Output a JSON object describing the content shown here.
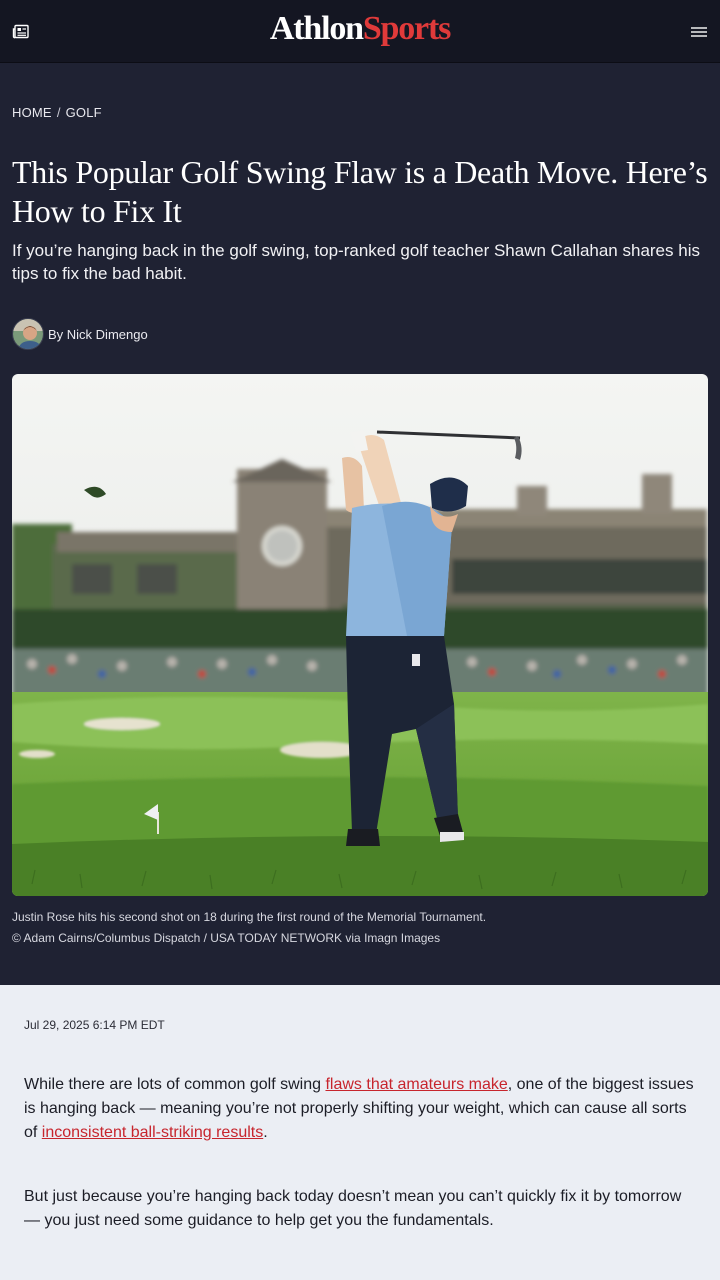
{
  "header": {
    "logo_part1": "Athlon",
    "logo_part2": "Sports",
    "left_icon": "newspaper-icon",
    "right_icon": "hamburger-menu-icon",
    "accent_color": "#e03a3a"
  },
  "breadcrumb": {
    "home": "HOME",
    "separator": "/",
    "section": "GOLF"
  },
  "article": {
    "title": "This Popular Golf Swing Flaw is a Death Move. Here’s How to Fix It",
    "dek": "If you’re hanging back in the golf swing, top-ranked golf teacher Shawn Callahan shares his tips to fix the bad habit.",
    "byline": "By Nick Dimengo",
    "caption_line1": "Justin Rose hits his second shot on 18 during the first round of the Memorial Tournament.",
    "caption_line2": "© Adam Cairns/Columbus Dispatch / USA TODAY NETWORK via Imagn Images",
    "date": "Jul 29, 2025 6:14 PM EDT",
    "p1_before": "While there are lots of common golf swing ",
    "p1_link1": "flaws that amateurs make",
    "p1_middle": ", one of the biggest issues is hanging back — meaning you’re not properly shifting your weight, which can cause all sorts of ",
    "p1_link2": "inconsistent ball-striking results",
    "p1_after": ".",
    "p2": "But just because you’re hanging back today doesn’t mean you can’t quickly fix it by tomorrow — you just need some guidance to help get you the fundamentals."
  }
}
